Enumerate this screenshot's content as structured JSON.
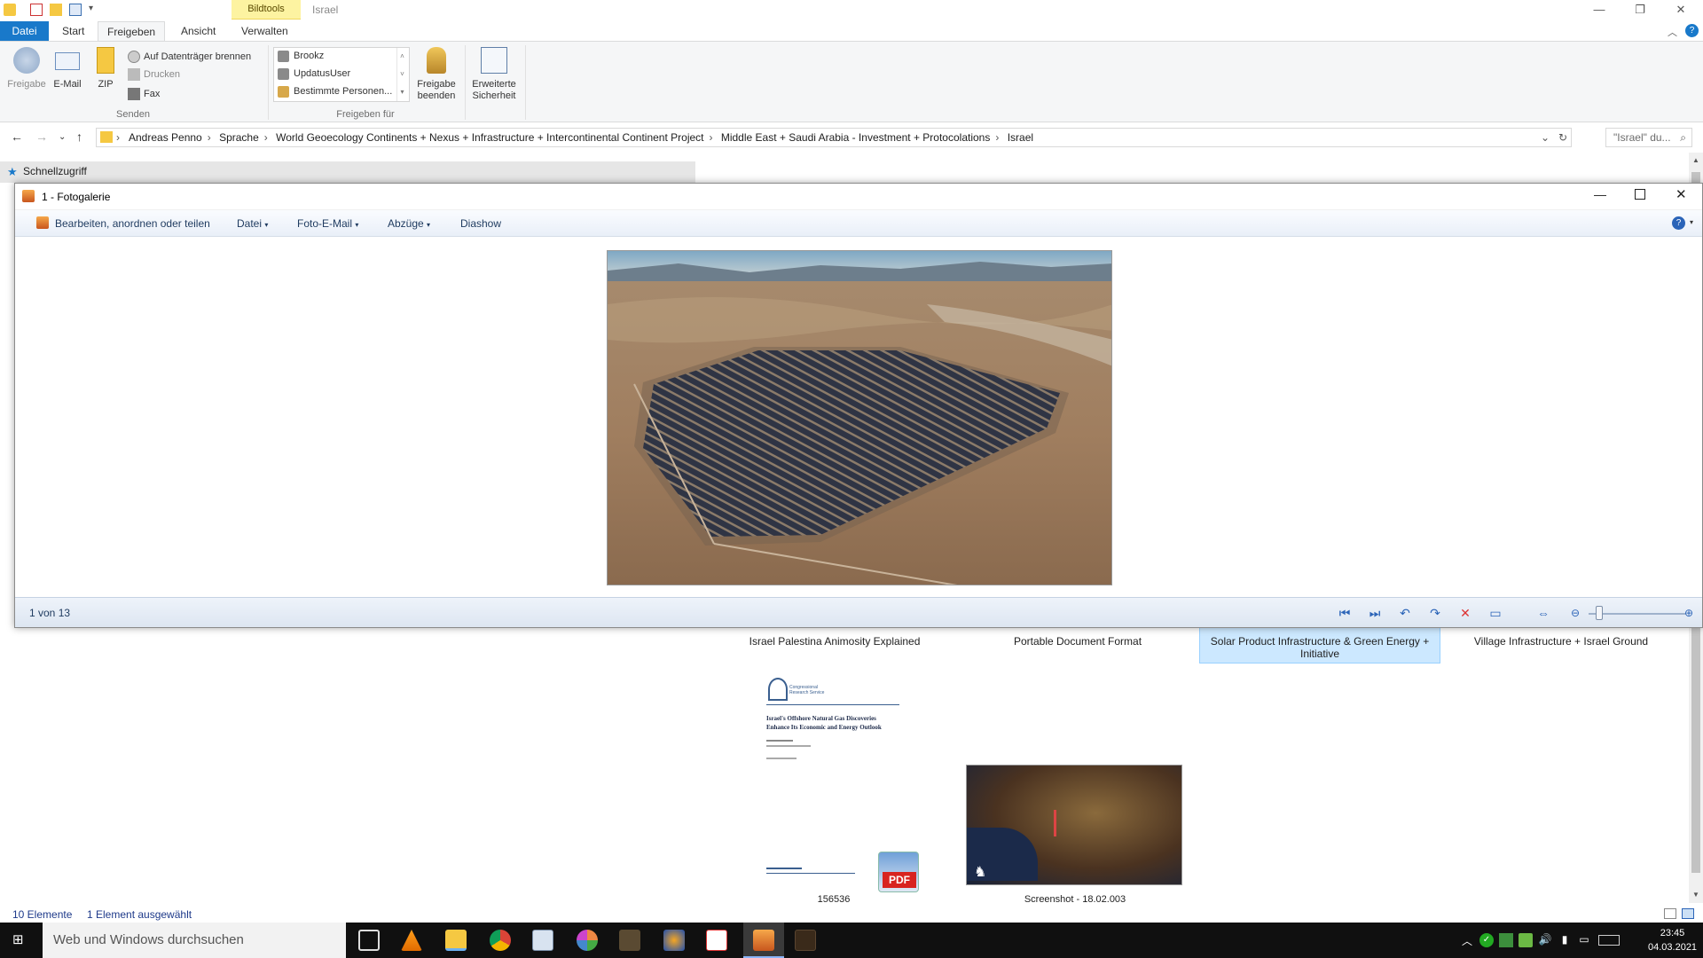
{
  "titlebar": {
    "context_tab": "Bildtools",
    "title": "Israel",
    "minimize": "—",
    "restore": "❐",
    "close": "✕"
  },
  "tabs": {
    "file": "Datei",
    "start": "Start",
    "share": "Freigeben",
    "view": "Ansicht",
    "manage": "Verwalten"
  },
  "ribbon": {
    "share_label": "Freigabe",
    "email_label": "E-Mail",
    "zip_label": "ZIP",
    "burn_label": "Auf Datenträger brennen",
    "print_label": "Drucken",
    "fax_label": "Fax",
    "send_group": "Senden",
    "people": [
      "Brookz",
      "UpdatusUser",
      "Bestimmte Personen..."
    ],
    "stop_share_line1": "Freigabe",
    "stop_share_line2": "beenden",
    "adv_sec_line1": "Erweiterte",
    "adv_sec_line2": "Sicherheit",
    "share_for_group": "Freigeben für"
  },
  "address": {
    "crumbs": [
      "Andreas Penno",
      "Sprache",
      "World Geoecology Continents + Nexus + Infrastructure + Intercontinental Continent Project",
      "Middle East + Saudi Arabia - Investment + Protocolations",
      "Israel"
    ],
    "search_placeholder": "\"Israel\" du..."
  },
  "navpane": {
    "quick_access": "Schnellzugriff"
  },
  "photo_viewer": {
    "title": "1 - Fotogalerie",
    "menu": [
      "Bearbeiten, anordnen oder teilen",
      "Datei",
      "Foto-E-Mail",
      "Abzüge",
      "Diashow"
    ],
    "count": "1 von 13"
  },
  "files": {
    "names": [
      "Israel Palestina Animosity Explained",
      "Portable Document Format",
      "Solar Product Infrastructure & Green Energy + Initiative",
      "Village Infrastructure + Israel Ground"
    ],
    "doc_title1": "Israel's Offshore Natural Gas Discoveries",
    "doc_title2": "Enhance Its Economic and Energy Outlook",
    "doc_org": "Congressional Research Service",
    "pdf_badge": "PDF",
    "file_156536": "156536",
    "file_screenshot": "Screenshot - 18.02.003"
  },
  "statusbar": {
    "items": "10 Elemente",
    "selected": "1 Element ausgewählt"
  },
  "taskbar": {
    "search": "Web und Windows durchsuchen",
    "time": "23:45",
    "date": "04.03.2021"
  }
}
